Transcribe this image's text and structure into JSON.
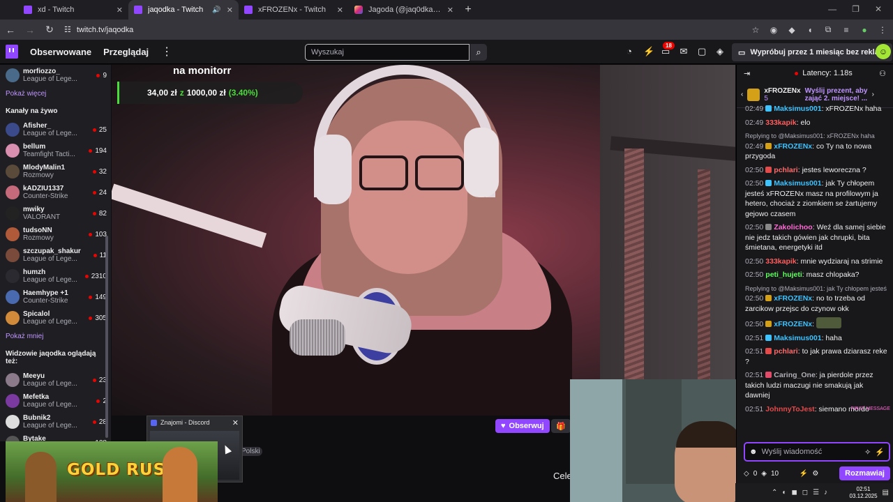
{
  "browser": {
    "tabs": [
      {
        "title": "xd - Twitch",
        "type": "twitch",
        "active": false
      },
      {
        "title": "jaqodka - Twitch",
        "type": "twitch",
        "active": true
      },
      {
        "title": "xFROZENx - Twitch",
        "type": "twitch",
        "active": false
      },
      {
        "title": "Jagoda (@jaq0dka) • Zdjęcia i",
        "type": "instagram",
        "active": false
      }
    ],
    "url": "twitch.tv/jaqodka"
  },
  "topnav": {
    "following": "Obserwowane",
    "browse": "Przeglądaj",
    "search_placeholder": "Wyszukaj",
    "notification_count": "18",
    "prime_cta": "Wypróbuj przez 1 miesiąc bez reklam"
  },
  "sidebar": {
    "top_channel": {
      "name": "morfiozzo_",
      "game": "League of Lege...",
      "viewers": "9"
    },
    "show_more": "Pokaż więcej",
    "live_header": "Kanały na żywo",
    "live": [
      {
        "name": "Afisher_",
        "game": "League of Lege...",
        "viewers": "25",
        "color": "#3b4a8a"
      },
      {
        "name": "bellum",
        "game": "Teamfight Tacti...",
        "viewers": "194",
        "color": "#d98fb0"
      },
      {
        "name": "MlodyMalin1",
        "game": "Rozmowy",
        "viewers": "32",
        "color": "#5a4a3a"
      },
      {
        "name": "kADZIU1337",
        "game": "Counter-Strike",
        "viewers": "24",
        "color": "#c46a7a"
      },
      {
        "name": "mwiky",
        "game": "VALORANT",
        "viewers": "82",
        "color": "#222"
      },
      {
        "name": "tudsoNN",
        "game": "Rozmowy",
        "viewers": "103",
        "color": "#b05a3a"
      },
      {
        "name": "szczupak_shakur",
        "game": "League of Lege...",
        "viewers": "11",
        "color": "#7a4a3a"
      },
      {
        "name": "humzh",
        "game": "League of Lege...",
        "viewers": "2310",
        "color": "#2a2a30"
      },
      {
        "name": "Haemhype +1",
        "game": "Counter-Strike",
        "viewers": "149",
        "color": "#4a6ab0"
      },
      {
        "name": "Spicalol",
        "game": "League of Lege...",
        "viewers": "305",
        "color": "#d08a3a"
      }
    ],
    "show_less": "Pokaż mniej",
    "also_watch_header": "Widzowie jaqodka oglądają też:",
    "also_watch": [
      {
        "name": "Meeyu",
        "game": "League of Lege...",
        "viewers": "23",
        "color": "#8a7a8a"
      },
      {
        "name": "Mefetka",
        "game": "League of Lege...",
        "viewers": "2",
        "color": "#7a3aa0"
      },
      {
        "name": "Bubnik2",
        "game": "League of Lege...",
        "viewers": "28",
        "color": "#ddd"
      },
      {
        "name": "Bytake",
        "game": "League of Lege...",
        "viewers": "128",
        "color": "#555"
      }
    ]
  },
  "stream": {
    "overlay_title": "na monitorr",
    "goal_current": "34,00 zł",
    "goal_sep": "z",
    "goal_target": "1000,00 zł",
    "goal_percent": "(3.40%)",
    "follow": "Obserwuj",
    "lang_tag": "Polski",
    "cele_text": "Cele"
  },
  "discord_popup": {
    "title": "Znajomi - Discord"
  },
  "ad": {
    "text": "GOLD RUSH"
  },
  "chat": {
    "latency": "Latency: 1.18s",
    "gift_user": "xFROZENx",
    "gift_count": "5",
    "gift_cta": "Wyślij prezent, aby zająć 2. miejsce! ...",
    "messages": [
      {
        "ts": "02:49",
        "user": "Maksimus001",
        "color": "#3ec3ff",
        "badge": "#3ec3ff",
        "text": "xFROZENx haha",
        "reply": ""
      },
      {
        "ts": "02:49",
        "user": "333kapik",
        "color": "#ff5e5e",
        "badge": "",
        "text": "elo",
        "reply": ""
      },
      {
        "ts": "02:49",
        "user": "xFROZENx",
        "color": "#3ec3ff",
        "badge": "#d4a017",
        "text": "co Ty na to  nowa przygoda",
        "reply": "Replying to @Maksimus001: xFROZENx haha"
      },
      {
        "ts": "02:50",
        "user": "pchlari",
        "color": "#ff6b6b",
        "badge": "#e34b4b",
        "text": "jestes leworeczna ?",
        "reply": ""
      },
      {
        "ts": "02:50",
        "user": "Maksimus001",
        "color": "#3ec3ff",
        "badge": "#3ec3ff",
        "text": "jak Ty chłopem jesteś xFROZENx masz na profilowym  ja hetero, chociaż z ziomkiem se żartujemy gejowo czasem",
        "reply": ""
      },
      {
        "ts": "02:50",
        "user": "Zakolichoo",
        "color": "#ff6bd5",
        "badge": "#888",
        "text": "Weź dla samej siebie nie jedz takich gówien jak chrupki, bita śmietana, energetyki itd",
        "reply": ""
      },
      {
        "ts": "02:50",
        "user": "333kapik",
        "color": "#ff5e5e",
        "badge": "",
        "text": "mnie wydziaraj na strimie",
        "reply": ""
      },
      {
        "ts": "02:50",
        "user": "peti_hujeti",
        "color": "#5cff5c",
        "badge": "",
        "text": "masz chlopaka?",
        "reply": ""
      },
      {
        "ts": "02:50",
        "user": "xFROZENx",
        "color": "#3ec3ff",
        "badge": "#d4a017",
        "text": "no to trzeba od zarcikow przejsc do czynow okk",
        "reply": "Replying to @Maksimus001: jak Ty chłopem jesteś"
      },
      {
        "ts": "02:50",
        "user": "xFROZENx",
        "color": "#3ec3ff",
        "badge": "#d4a017",
        "text": "",
        "reply": ""
      },
      {
        "ts": "02:51",
        "user": "Maksimus001",
        "color": "#3ec3ff",
        "badge": "#3ec3ff",
        "text": "haha",
        "reply": ""
      },
      {
        "ts": "02:51",
        "user": "pchlari",
        "color": "#ff6b6b",
        "badge": "#e34b4b",
        "text": "to jak prawa dziarasz reke ?",
        "reply": ""
      },
      {
        "ts": "02:51",
        "user": "Caring_One",
        "color": "#b0b0b5",
        "badge": "#e34b6b",
        "text": "ja pierdole przez takich ludzi maczugi nie smakują jak dawniej",
        "reply": ""
      },
      {
        "ts": "02:51",
        "user": "JohnnyToJest",
        "color": "#e34b4b",
        "badge": "",
        "text": "siemano mordo",
        "reply": ""
      }
    ],
    "first_message_tag": "FIRST MESSAGE",
    "input_placeholder": "Wyślij wiadomość",
    "points_a": "0",
    "points_b": "10",
    "send_button": "Rozmawiaj"
  },
  "taskbar": {
    "time": "02:51",
    "date": "03.12.2025"
  }
}
